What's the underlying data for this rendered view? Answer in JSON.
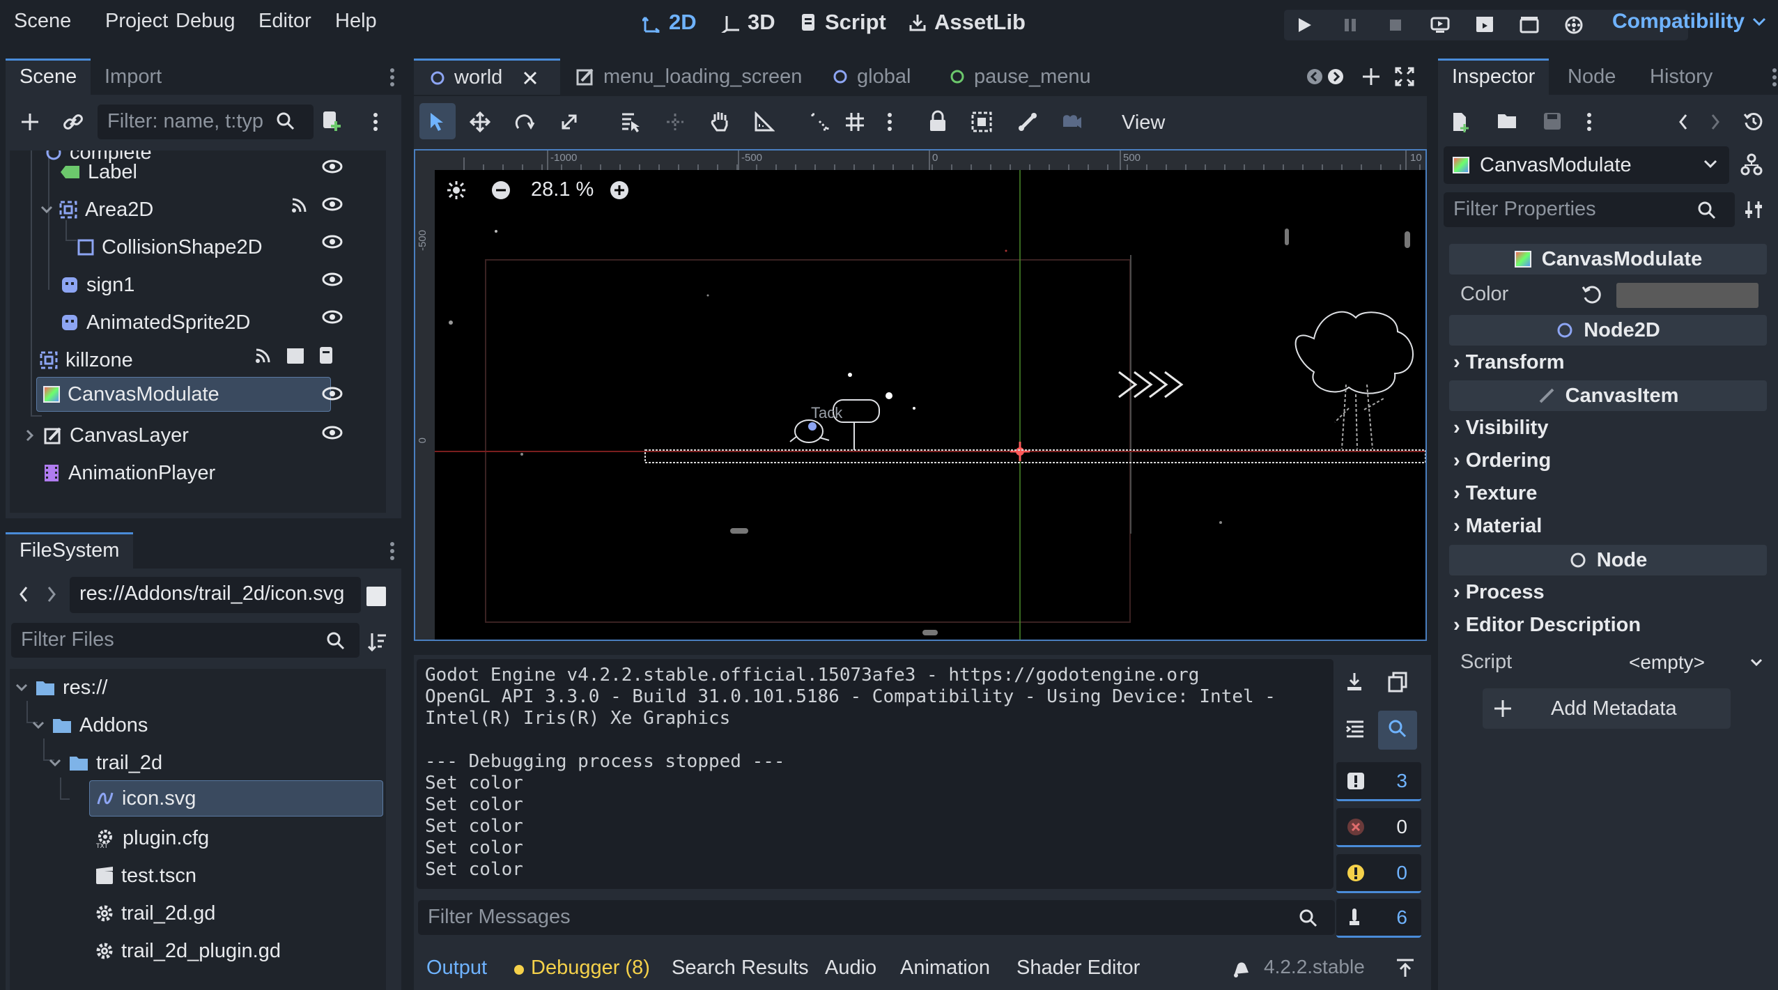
{
  "menu": [
    "Scene",
    "Project",
    "Debug",
    "Editor",
    "Help"
  ],
  "workspaces": [
    {
      "label": "2D",
      "icon": "2d-icon",
      "active": true
    },
    {
      "label": "3D",
      "icon": "3d-icon",
      "active": false
    },
    {
      "label": "Script",
      "icon": "script-icon",
      "active": false
    },
    {
      "label": "AssetLib",
      "icon": "assetlib-icon",
      "active": false
    }
  ],
  "renderer": "Compatibility",
  "scene_dock": {
    "tabs": [
      "Scene",
      "Import"
    ],
    "filter_placeholder": "Filter: name, t:typ",
    "nodes": [
      {
        "label": "complete",
        "icon": "node2d-icon"
      },
      {
        "label": "Label",
        "icon": "label-icon"
      },
      {
        "label": "Area2D",
        "icon": "area2d-icon"
      },
      {
        "label": "CollisionShape2D",
        "icon": "collisionshape-icon"
      },
      {
        "label": "sign1",
        "icon": "sprite-icon"
      },
      {
        "label": "AnimatedSprite2D",
        "icon": "animatedsprite-icon"
      },
      {
        "label": "killzone",
        "icon": "area2d-icon"
      },
      {
        "label": "CanvasModulate",
        "icon": "canvasmodulate-icon"
      },
      {
        "label": "CanvasLayer",
        "icon": "canvaslayer-icon"
      },
      {
        "label": "AnimationPlayer",
        "icon": "animationplayer-icon"
      }
    ]
  },
  "filesystem": {
    "tab": "FileSystem",
    "path": "res://Addons/trail_2d/icon.svg",
    "filter_placeholder": "Filter Files",
    "items": [
      {
        "label": "res://",
        "icon": "folder-icon"
      },
      {
        "label": "Addons",
        "icon": "folder-icon"
      },
      {
        "label": "trail_2d",
        "icon": "folder-icon"
      },
      {
        "label": "icon.svg",
        "icon": "svg-file-icon"
      },
      {
        "label": "plugin.cfg",
        "icon": "cfg-file-icon"
      },
      {
        "label": "test.tscn",
        "icon": "scene-file-icon"
      },
      {
        "label": "trail_2d.gd",
        "icon": "gear-icon"
      },
      {
        "label": "trail_2d_plugin.gd",
        "icon": "gear-icon"
      }
    ]
  },
  "scene_tabs": [
    {
      "label": "world",
      "icon": "node-circle-icon",
      "active": true
    },
    {
      "label": "menu_loading_screen",
      "icon": "canvaslayer-icon",
      "active": false
    },
    {
      "label": "global",
      "icon": "node-circle-icon",
      "active": false
    },
    {
      "label": "pause_menu",
      "icon": "node-circle-icon",
      "active": false
    }
  ],
  "viewport": {
    "view_label": "View",
    "zoom": "28.1 %",
    "ruler_top": [
      "-1000",
      "-500",
      "0",
      "500",
      "10"
    ],
    "ruler_left": [
      "-500",
      "0"
    ],
    "sprite_text": "Tack"
  },
  "output": {
    "lines": [
      "Godot Engine v4.2.2.stable.official.15073afe3 - https://godotengine.org",
      "OpenGL API 3.3.0 - Build 31.0.101.5186 - Compatibility - Using Device: Intel -",
      "Intel(R) Iris(R) Xe Graphics",
      "",
      "--- Debugging process stopped ---",
      "Set color",
      "Set color",
      "Set color",
      "Set color",
      "Set color"
    ],
    "filter_placeholder": "Filter Messages",
    "counts": {
      "warnings_total": "3",
      "errors": "0",
      "warnings": "0",
      "messages": "6"
    }
  },
  "bottom_tabs": [
    "Output",
    "Debugger (8)",
    "Search Results",
    "Audio",
    "Animation",
    "Shader Editor"
  ],
  "version": "4.2.2.stable",
  "inspector": {
    "tabs": [
      "Inspector",
      "Node",
      "History"
    ],
    "object": "CanvasModulate",
    "filter_placeholder": "Filter Properties",
    "section_canvasmodulate": "CanvasModulate",
    "color_label": "Color",
    "color_value": "#5a5a5a",
    "section_node2d": "Node2D",
    "transform": "Transform",
    "section_canvasitem": "CanvasItem",
    "groups": [
      "Visibility",
      "Ordering",
      "Texture",
      "Material"
    ],
    "section_node": "Node",
    "node_groups": [
      "Process",
      "Editor Description"
    ],
    "script_label": "Script",
    "script_value": "<empty>",
    "add_metadata": "Add Metadata"
  },
  "colors": {
    "accent": "#4a8cd9",
    "accent_text": "#6fb3ff",
    "warning": "#f5d14a",
    "error": "#e06c6c",
    "node2d": "#8da5f3"
  }
}
